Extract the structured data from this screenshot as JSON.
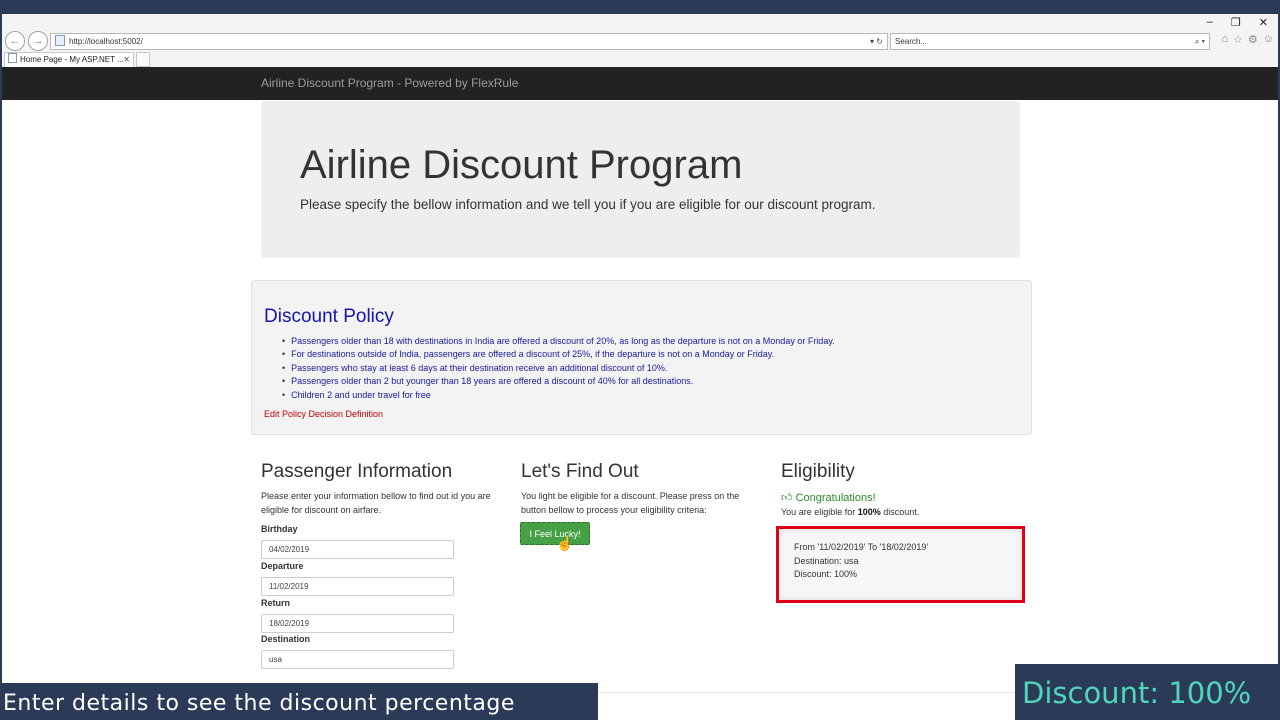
{
  "browser": {
    "url": "http://localhost:5002/",
    "search_placeholder": "Search...",
    "tab_title": "Home Page - My ASP.NET ...",
    "tab_close": "✕",
    "win_min": "–",
    "win_restore": "❐",
    "win_close": "✕"
  },
  "navbar": {
    "brand": "Airline Discount Program - Powered by FlexRule"
  },
  "jumbotron": {
    "title": "Airline Discount Program",
    "subtitle": "Please specify the bellow information and we tell you if you are eligible for our discount program."
  },
  "policy": {
    "title": "Discount Policy",
    "items": [
      "Passengers older than 18 with destinations in India are offered a discount of 20%, as long as the departure is not on a Monday or Friday.",
      "For destinations outside of India, passengers are offered a discount of 25%, if the departure is not on a Monday or Friday.",
      "Passengers who stay at least 6 days at their destination receive an additional discount of 10%.",
      "Passengers older than 2 but younger than 18 years are offered a discount of 40% for all destinations.",
      "Children 2 and under travel for free"
    ],
    "edit_link": "Edit Policy Decision Definition"
  },
  "passenger": {
    "title": "Passenger Information",
    "description": "Please enter your information bellow to find out id you are eligible for discount on airfare.",
    "fields": {
      "birthday": {
        "label": "Birthday",
        "value": "04/02/2019"
      },
      "departure": {
        "label": "Departure",
        "value": "11/02/2019"
      },
      "return": {
        "label": "Return",
        "value": "18/02/2019"
      },
      "destination": {
        "label": "Destination",
        "value": "usa"
      }
    }
  },
  "find_out": {
    "title": "Let's Find Out",
    "description": "You light be eligible for a discount. Please press on the button bellow to process your eligibility criteria:",
    "button": "I Feel Lucky!"
  },
  "eligibility": {
    "title": "Eligibility",
    "congrats": "Congratulations!",
    "text_before": "You are eligible for ",
    "percent": "100%",
    "text_after": " discount.",
    "result": {
      "range": "From '11/02/2019' To '18/02/2019'",
      "destination": "Destination: usa",
      "discount": "Discount: 100%"
    }
  },
  "captions": {
    "left": "Enter details to see the discount percentage",
    "right": "Discount: 100%"
  },
  "colors": {
    "navbar": "#222222",
    "policy_text": "#1a1a9a",
    "button_green": "#45a046",
    "highlight_red": "#e0001a",
    "caption_bg": "#2b3b57",
    "caption_accent": "#4fd6b8"
  }
}
